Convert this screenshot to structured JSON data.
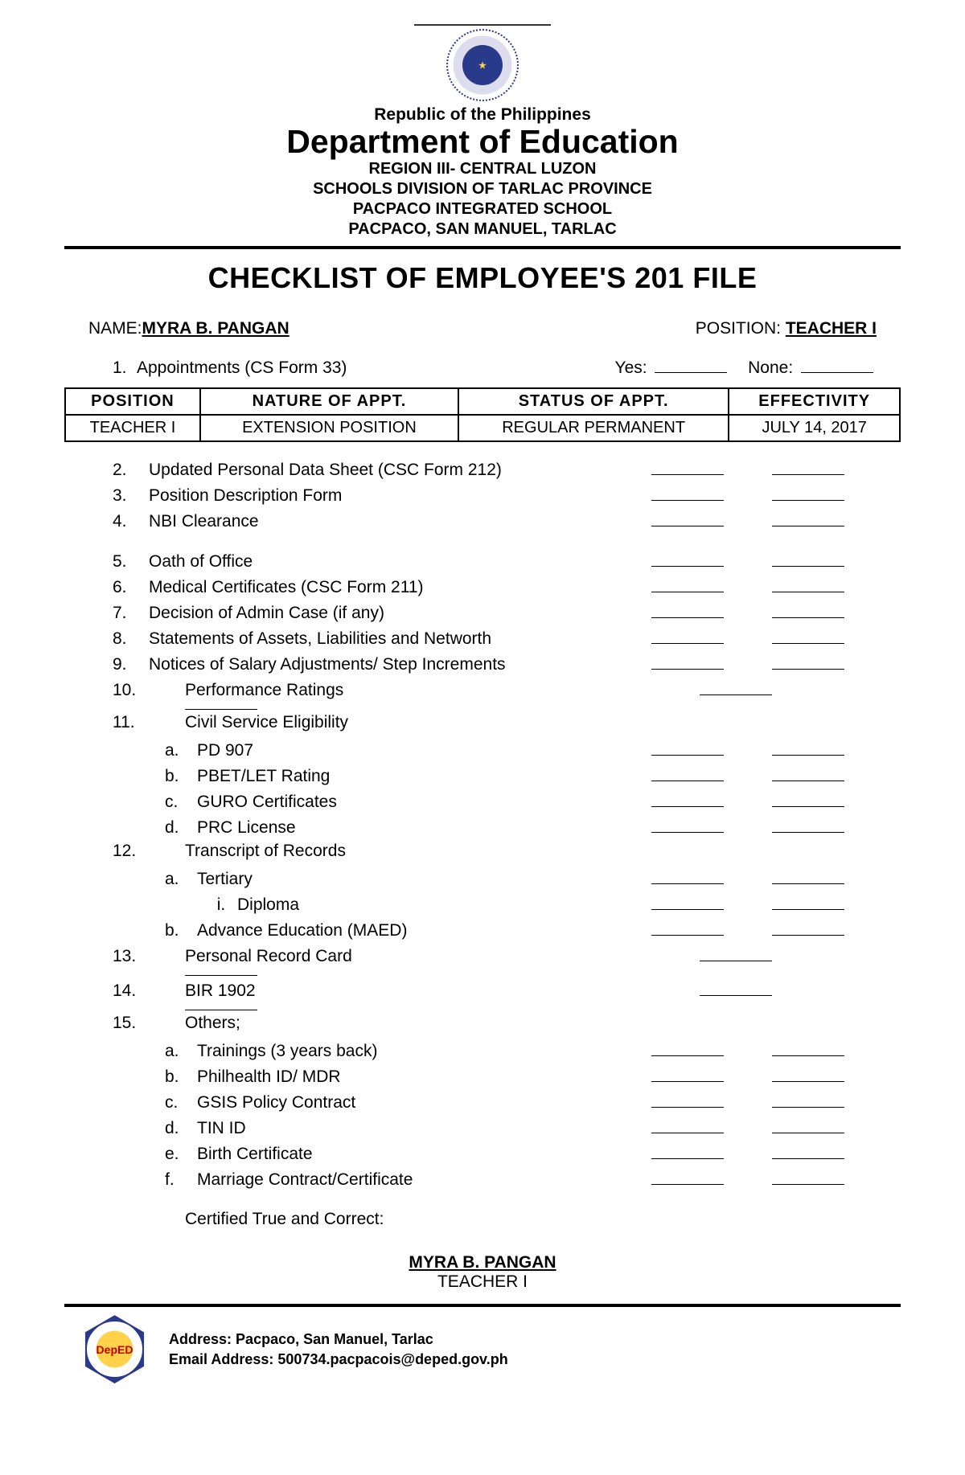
{
  "header": {
    "republic": "Republic of the Philippines",
    "department": "Department of Education",
    "region": "REGION III- CENTRAL LUZON",
    "division": "SCHOOLS DIVISION OF TARLAC PROVINCE",
    "school": "PACPACO INTEGRATED SCHOOL",
    "address_line": "PACPACO, SAN MANUEL, TARLAC"
  },
  "title": "CHECKLIST OF EMPLOYEE'S 201 FILE",
  "name_label": "NAME:",
  "name_value": "MYRA B. PANGAN",
  "position_label": "POSITION:",
  "position_value": "TEACHER I",
  "item1": {
    "num": "1.",
    "label": "Appointments (CS Form 33)",
    "yes": "Yes:",
    "none": "None:"
  },
  "appt_table": {
    "headers": [
      "POSITION",
      "NATURE OF APPT.",
      "STATUS OF APPT.",
      "EFFECTIVITY"
    ],
    "row": [
      "TEACHER I",
      "EXTENSION POSITION",
      "REGULAR PERMANENT",
      "JULY 14, 2017"
    ]
  },
  "items": {
    "i2": {
      "num": "2.",
      "text": "Updated Personal Data Sheet (CSC Form 212)"
    },
    "i3": {
      "num": "3.",
      "text": "Position Description Form"
    },
    "i4": {
      "num": "4.",
      "text": "NBI Clearance"
    },
    "i5": {
      "num": "5.",
      "text": "Oath of Office"
    },
    "i6": {
      "num": "6.",
      "text": "Medical Certificates (CSC Form 211)"
    },
    "i7": {
      "num": "7.",
      "text": "Decision of Admin Case (if any)"
    },
    "i8": {
      "num": "8.",
      "text": "Statements of Assets, Liabilities and Networth"
    },
    "i9": {
      "num": "9.",
      "text": "Notices of Salary Adjustments/ Step Increments"
    },
    "i10": {
      "num": "10.",
      "text": "Performance Ratings"
    },
    "i11": {
      "num": "11.",
      "text": "Civil Service Eligibility"
    },
    "i11a": {
      "letter": "a.",
      "text": "PD 907"
    },
    "i11b": {
      "letter": "b.",
      "text": "PBET/LET Rating"
    },
    "i11c": {
      "letter": "c.",
      "text": "GURO Certificates"
    },
    "i11d": {
      "letter": "d.",
      "text": "PRC License"
    },
    "i12": {
      "num": "12.",
      "text": "Transcript of Records"
    },
    "i12a": {
      "letter": "a.",
      "text": "Tertiary"
    },
    "i12ai": {
      "roman": "i.",
      "text": "Diploma"
    },
    "i12b": {
      "letter": "b.",
      "text": "Advance Education (MAED)"
    },
    "i13": {
      "num": "13.",
      "text": "Personal Record Card"
    },
    "i14": {
      "num": "14.",
      "text": "BIR 1902"
    },
    "i15": {
      "num": "15.",
      "text": "Others;"
    },
    "i15a": {
      "letter": "a.",
      "text": "Trainings (3 years back)"
    },
    "i15b": {
      "letter": "b.",
      "text": "Philhealth ID/ MDR"
    },
    "i15c": {
      "letter": "c.",
      "text": "GSIS Policy Contract"
    },
    "i15d": {
      "letter": "d.",
      "text": "TIN ID"
    },
    "i15e": {
      "letter": "e.",
      "text": "Birth Certificate"
    },
    "i15f": {
      "letter": "f.",
      "text": "Marriage Contract/Certificate"
    }
  },
  "cert_label": "Certified True and Correct:",
  "signatory": {
    "name": "MYRA B. PANGAN",
    "position": "TEACHER I"
  },
  "footer": {
    "address_label": "Address:",
    "address_value": "Pacpaco, San Manuel, Tarlac",
    "email_label": "Email Address:",
    "email_value": "500734.pacpacois@deped.gov.ph",
    "logo_text": "DepED"
  }
}
